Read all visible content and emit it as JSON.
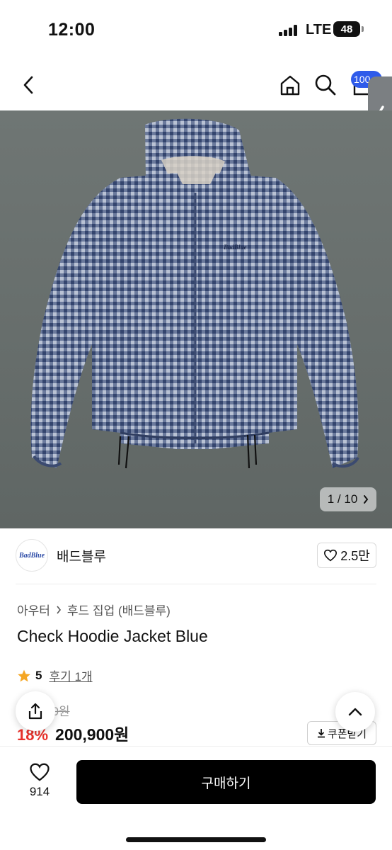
{
  "status_bar": {
    "time": "12:00",
    "network": "LTE",
    "battery": "48"
  },
  "nav": {
    "cart_count": "100"
  },
  "hero": {
    "counter_current": "1",
    "counter_sep": "/",
    "counter_total": "10",
    "jacket_logo": "BadBlue"
  },
  "brand": {
    "logo_text": "BadBlue",
    "name": "배드블루",
    "likes": "2.5만"
  },
  "breadcrumb": [
    "아우터",
    "후드 집업 (배드블루)"
  ],
  "product": {
    "title": "Check Hoodie Jacket Blue",
    "rating": "5",
    "review_label": "후기 1개",
    "original_price": "00원",
    "discount": "18%",
    "price": "200,900원",
    "coupon_label": "쿠폰받기"
  },
  "bottom_bar": {
    "wish_count": "914",
    "buy_label": "구매하기"
  },
  "colors": {
    "accent": "#2f5bea",
    "discount": "#e8312b",
    "star": "#f5a623",
    "buy_button": "#000000"
  },
  "icons": [
    "back-icon",
    "home-icon",
    "search-icon",
    "cart-icon",
    "chevron-left-icon",
    "chevron-right-icon",
    "heart-icon",
    "star-icon",
    "share-icon",
    "chevron-up-icon",
    "download-icon"
  ]
}
